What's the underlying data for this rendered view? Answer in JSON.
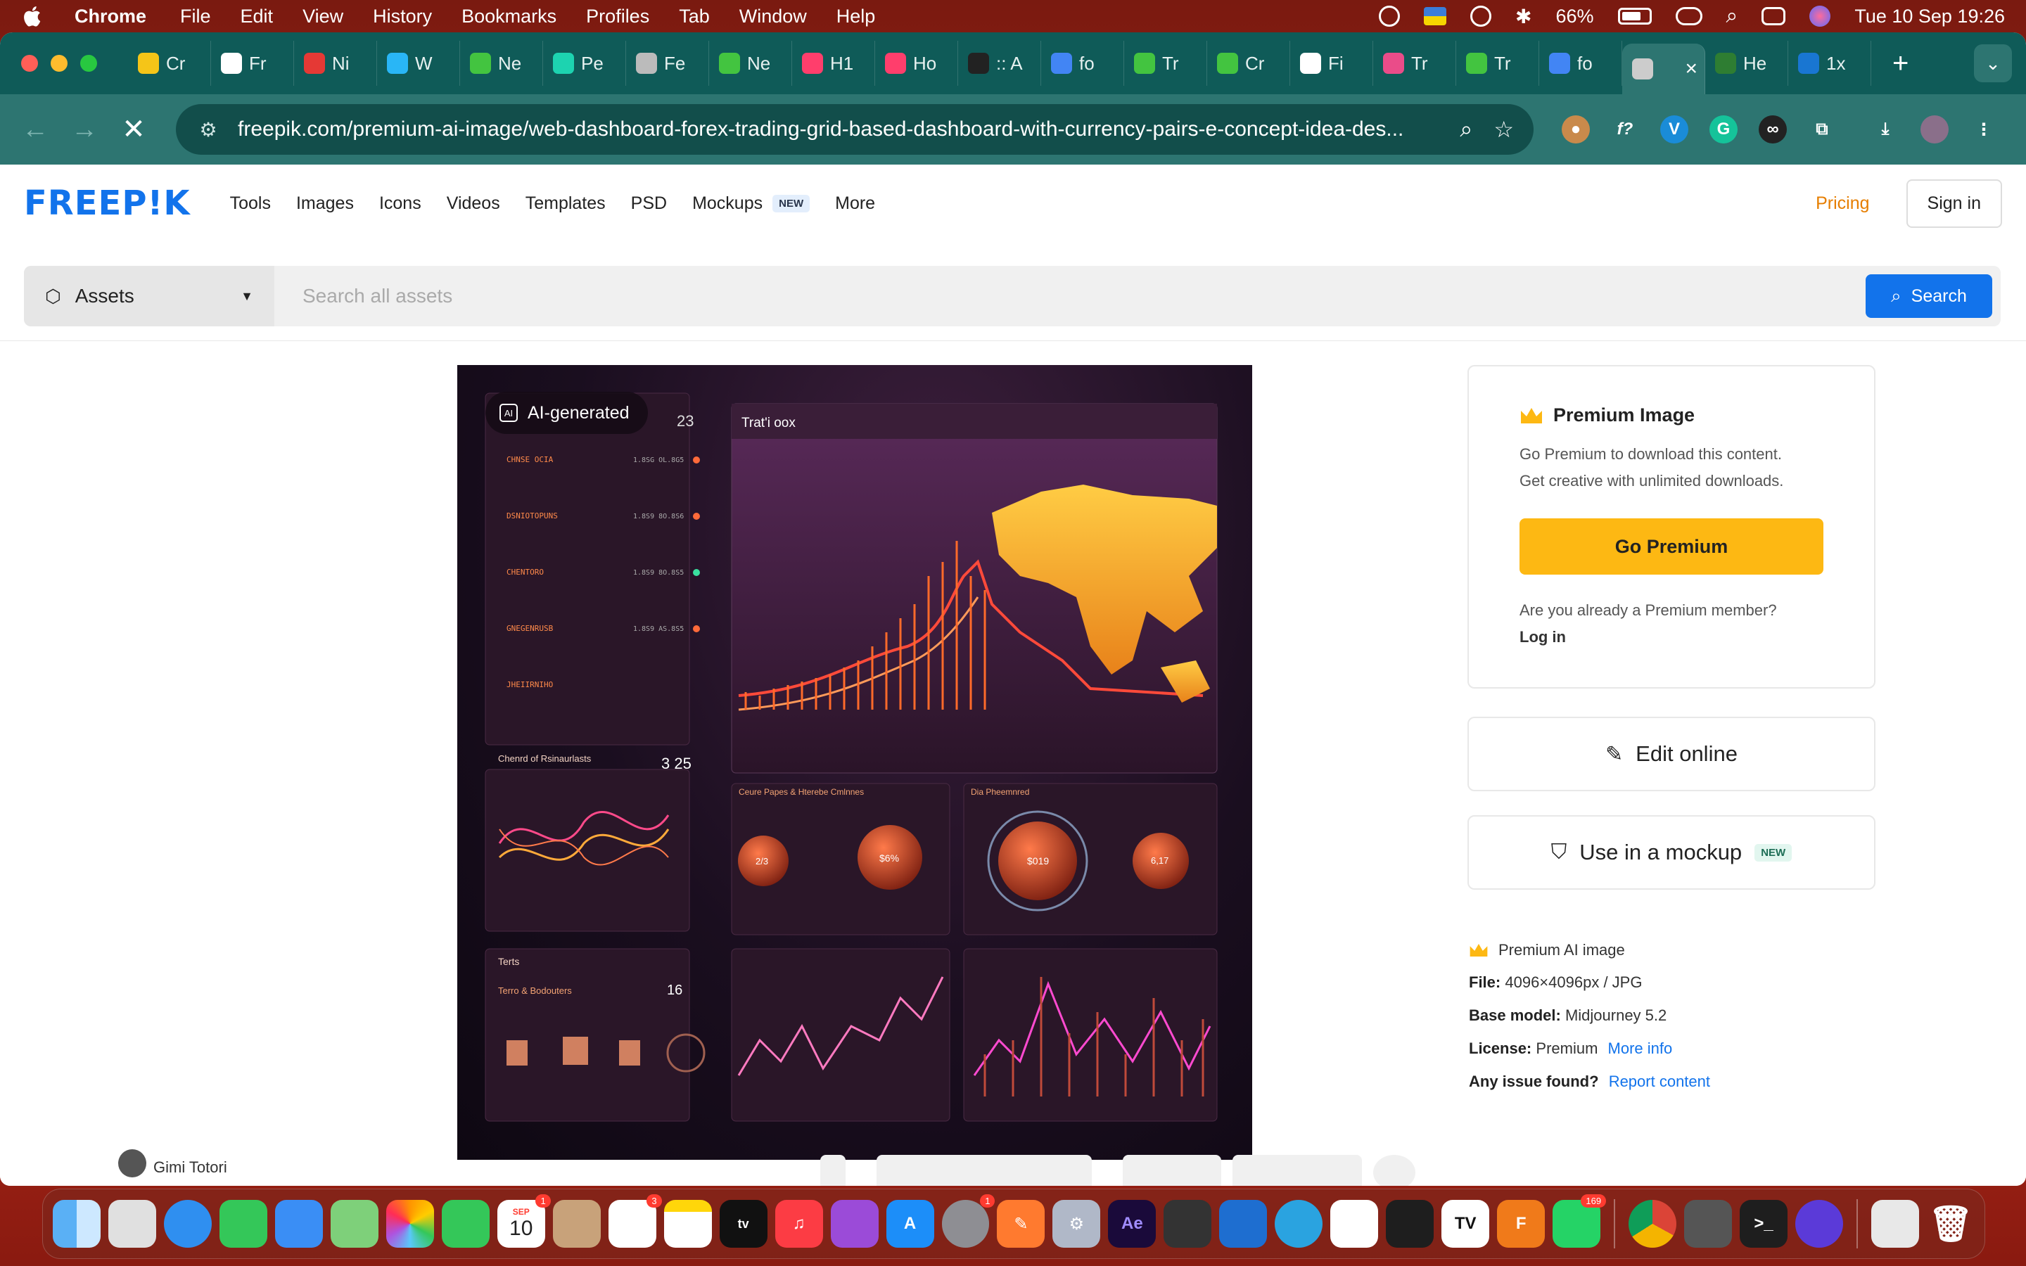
{
  "menubar": {
    "app_name": "Chrome",
    "items": [
      "File",
      "Edit",
      "View",
      "History",
      "Bookmarks",
      "Profiles",
      "Tab",
      "Window",
      "Help"
    ],
    "battery": "66%",
    "datetime": "Tue 10 Sep  19:26"
  },
  "tabs": [
    {
      "label": "Cr",
      "color": "#f5c518"
    },
    {
      "label": "Fr",
      "color": "#ffffff"
    },
    {
      "label": "Ni",
      "color": "#e53935"
    },
    {
      "label": "W",
      "color": "#29b6f6"
    },
    {
      "label": "Ne",
      "color": "#43c440"
    },
    {
      "label": "Pe",
      "color": "#1dd3b0"
    },
    {
      "label": "Fe",
      "color": "#bbbbbb"
    },
    {
      "label": "Ne",
      "color": "#43c440"
    },
    {
      "label": "H1",
      "color": "#ff3e6c"
    },
    {
      "label": "Ho",
      "color": "#ff3e6c"
    },
    {
      "label": ":: A",
      "color": "#222222"
    },
    {
      "label": "fo",
      "color": "#4285f4"
    },
    {
      "label": "Tr",
      "color": "#43c440"
    },
    {
      "label": "Cr",
      "color": "#43c440"
    },
    {
      "label": "Fi",
      "color": "#ffffff"
    },
    {
      "label": "Tr",
      "color": "#ea4c89"
    },
    {
      "label": "Tr",
      "color": "#43c440"
    },
    {
      "label": "fo",
      "color": "#4285f4"
    },
    {
      "label": "",
      "color": "#cccccc",
      "active": true
    },
    {
      "label": "He",
      "color": "#2e7d32"
    },
    {
      "label": "1x",
      "color": "#1976d2"
    }
  ],
  "omnibox": {
    "url": "freepik.com/premium-ai-image/web-dashboard-forex-trading-grid-based-dashboard-with-currency-pairs-e-concept-idea-des..."
  },
  "site": {
    "logo": "FREEP!K",
    "nav": [
      "Tools",
      "Images",
      "Icons",
      "Videos",
      "Templates",
      "PSD",
      "Mockups",
      "More"
    ],
    "mockups_badge": "NEW",
    "pricing": "Pricing",
    "signin": "Sign in"
  },
  "search": {
    "asset_type": "Assets",
    "placeholder": "Search all assets",
    "button": "Search"
  },
  "artwork": {
    "chip": "AI-generated",
    "panel_title": "Trat'i oox",
    "left_number": "23",
    "mid_number": "3 25",
    "right_number": "16",
    "bottom_left_title": "Terts",
    "bottom_left_sub": "Terro & Bodouters",
    "rates_title": "Chenrd of Rsinaurlasts",
    "pair_panel_title": "Ceure Papes & Hterebe Cmlnnes",
    "globe_title": "Dia Pheemnred",
    "bubble1": "2/3",
    "bubble2": "$6%",
    "bubble3": "$019",
    "bubble4": "6,17"
  },
  "sidebar": {
    "premium_title": "Premium Image",
    "premium_desc_1": "Go Premium to download this content.",
    "premium_desc_2": "Get creative with unlimited downloads.",
    "go_premium": "Go Premium",
    "already": "Are you already a Premium member?",
    "login": "Log in",
    "edit_online": "Edit online",
    "use_mockup": "Use in a mockup",
    "mockup_badge": "NEW",
    "meta_type": "Premium AI image",
    "file_label": "File:",
    "file_value": "4096×4096px / JPG",
    "model_label": "Base model:",
    "model_value": "Midjourney 5.2",
    "license_label": "License:",
    "license_value": "Premium",
    "more_info": "More info",
    "issue_label": "Any issue found?",
    "report": "Report content"
  },
  "author": "Gimi Totori",
  "dock": {
    "calendar_month": "SEP",
    "calendar_day": "10",
    "badges": {
      "calendar": "1",
      "reminders": "3",
      "settings": "1",
      "whatsapp": "169"
    }
  },
  "colors": {
    "brand_blue": "#1273eb",
    "premium_yellow": "#fdb813",
    "pricing_orange": "#e67e00",
    "chrome_teal": "#2d7571"
  }
}
